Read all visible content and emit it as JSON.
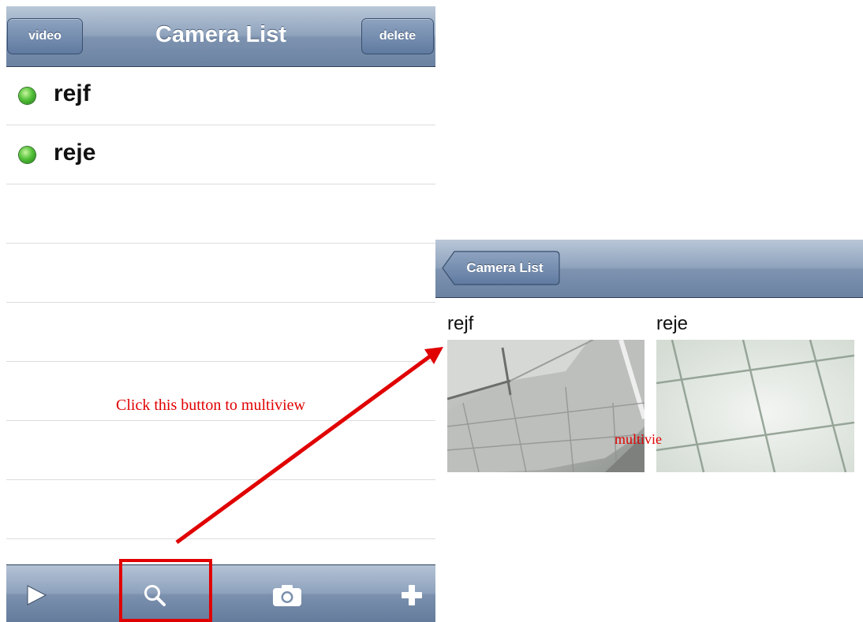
{
  "left_screen": {
    "title": "Camera List",
    "video_button": "video",
    "delete_button": "delete",
    "cameras": [
      {
        "name": "rejf",
        "status": "online"
      },
      {
        "name": "reje",
        "status": "online"
      }
    ],
    "toolbar": [
      "play-icon",
      "search-icon",
      "camera-icon",
      "add-icon"
    ]
  },
  "right_screen": {
    "back_button": "Camera List",
    "views": [
      {
        "name": "rejf"
      },
      {
        "name": "reje"
      }
    ]
  },
  "annotations": {
    "instruction": "Click this button to multiview",
    "overlay_label": "multivie"
  },
  "colors": {
    "annotation": "#e00000",
    "status_online": "#3fae2a",
    "nav_bar": "#7d93b0"
  }
}
